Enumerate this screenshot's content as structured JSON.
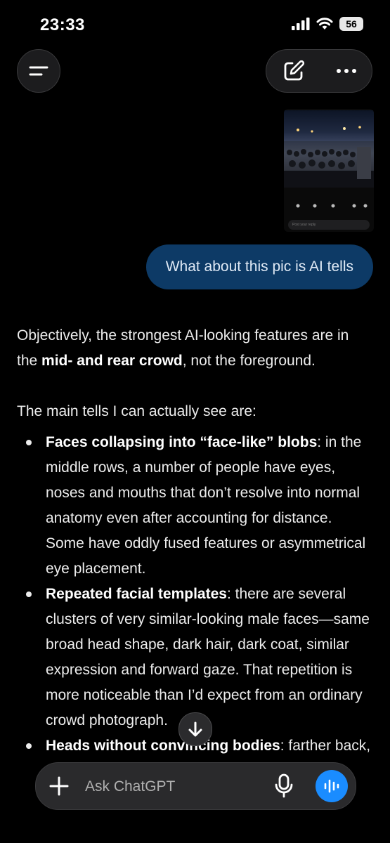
{
  "status_bar": {
    "time": "23:33",
    "battery": "56"
  },
  "attachment": {
    "reply_placeholder": "Post your reply"
  },
  "user_message": "What about this pic is AI tells",
  "response": {
    "intro_before": "Objectively, the strongest AI-looking features are in the ",
    "intro_bold": "mid- and rear crowd",
    "intro_after": ", not the foreground.",
    "lead": "The main tells I can actually see are:",
    "bullets": [
      {
        "title": "Faces collapsing into “face-like” blobs",
        "text": ": in the middle rows, a number of people have eyes, noses and mouths that don’t resolve into normal anatomy even after accounting for distance. Some have oddly fused features or asymmetrical eye placement."
      },
      {
        "title": "Repeated facial templates",
        "text": ": there are several clusters of very similar-looking male faces—same broad head shape, dark hair, dark coat, similar expression and forward gaze. That repetition is more noticeable than I’d expect from an ordinary crowd photograph."
      },
      {
        "title": "Heads without convincing bodies",
        "text": ": farther back, some heads appear packed into"
      }
    ]
  },
  "composer": {
    "placeholder": "Ask ChatGPT"
  },
  "icons": {
    "menu": "menu-icon",
    "edit": "new-chat-icon",
    "more": "more-icon",
    "scroll": "arrow-down-icon",
    "plus": "plus-icon",
    "mic": "microphone-icon",
    "voice": "voice-mode-icon"
  },
  "colors": {
    "background": "#000000",
    "user_bubble": "#0d3a66",
    "voice_button": "#1a8cff"
  }
}
